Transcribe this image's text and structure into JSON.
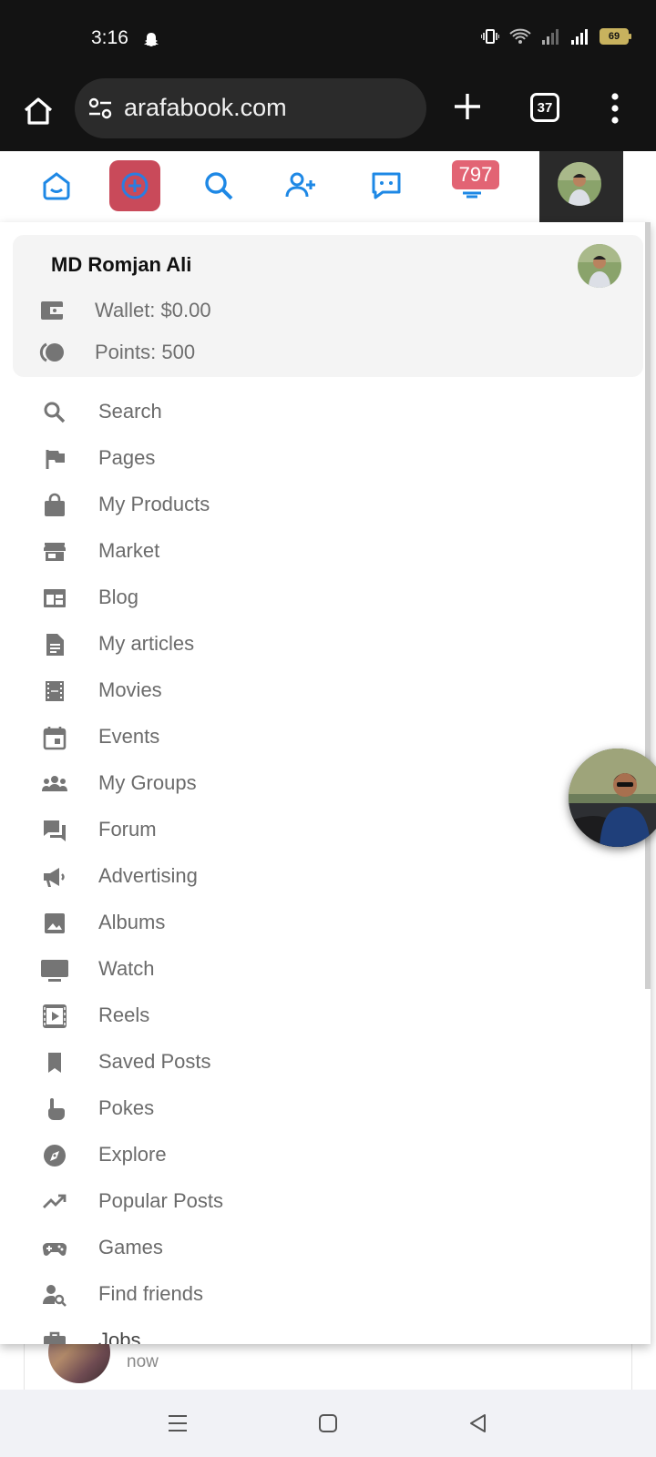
{
  "status_bar": {
    "time": "3:16",
    "battery": "69",
    "icons": [
      "snapchat-ghost-icon",
      "vibrate-icon",
      "wifi-icon",
      "signal-icon",
      "signal-icon",
      "battery-icon"
    ]
  },
  "browser": {
    "url": "arafabook.com",
    "tab_count": "37",
    "buttons": [
      "home-icon",
      "site-settings-icon",
      "new-tab-icon",
      "tab-switcher",
      "more-menu-icon"
    ]
  },
  "site_nav": {
    "notification_count": "797",
    "icons": [
      "home-icon",
      "add-circle-icon",
      "search-icon",
      "add-friend-icon",
      "messages-icon",
      "notifications-icon",
      "profile-avatar"
    ],
    "accent_color": "#1e88e5",
    "add_button_color": "#c94a5a",
    "badge_color": "#e26474"
  },
  "user_card": {
    "name": "MD Romjan Ali",
    "wallet": "Wallet: $0.00",
    "points": "Points: 500"
  },
  "menu": [
    {
      "label": "Search",
      "icon": "search-icon"
    },
    {
      "label": "Pages",
      "icon": "flag-icon"
    },
    {
      "label": "My Products",
      "icon": "shopping-bag-icon"
    },
    {
      "label": "Market",
      "icon": "store-icon"
    },
    {
      "label": "Blog",
      "icon": "blog-icon"
    },
    {
      "label": "My articles",
      "icon": "article-icon"
    },
    {
      "label": "Movies",
      "icon": "film-icon"
    },
    {
      "label": "Events",
      "icon": "calendar-icon"
    },
    {
      "label": "My Groups",
      "icon": "groups-icon"
    },
    {
      "label": "Forum",
      "icon": "forum-icon"
    },
    {
      "label": "Advertising",
      "icon": "megaphone-icon"
    },
    {
      "label": "Albums",
      "icon": "image-icon"
    },
    {
      "label": "Watch",
      "icon": "tv-icon"
    },
    {
      "label": "Reels",
      "icon": "reels-icon"
    },
    {
      "label": "Saved Posts",
      "icon": "bookmark-icon"
    },
    {
      "label": "Pokes",
      "icon": "poke-icon"
    },
    {
      "label": "Explore",
      "icon": "compass-icon"
    },
    {
      "label": "Popular Posts",
      "icon": "trending-icon"
    },
    {
      "label": "Games",
      "icon": "gamepad-icon"
    },
    {
      "label": "Find friends",
      "icon": "person-search-icon"
    },
    {
      "label": "Jobs",
      "icon": "briefcase-icon"
    }
  ],
  "background_post": {
    "time": "now"
  },
  "system_nav": [
    "recents-icon",
    "home-icon",
    "back-icon"
  ]
}
